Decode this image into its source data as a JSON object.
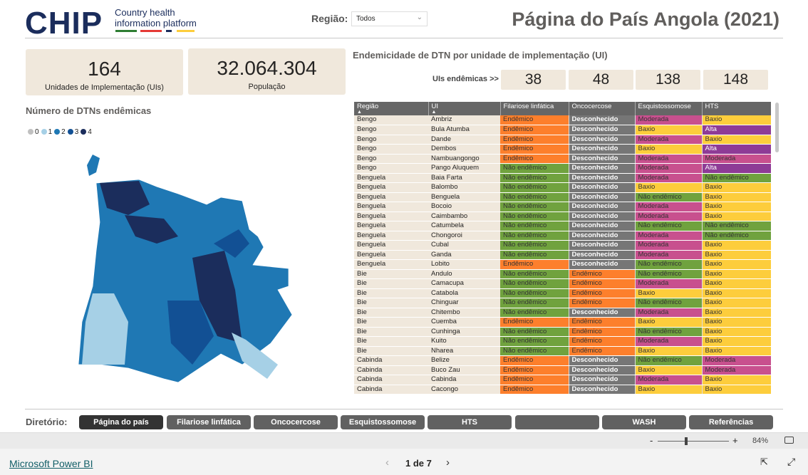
{
  "header": {
    "logo": "CHIP",
    "subtitle1": "Country health",
    "subtitle2": "information platform",
    "region_label": "Região:",
    "region_value": "Todos",
    "title": "Página do País Angola (2021)"
  },
  "cards": [
    {
      "value": "164",
      "label": "Unidades de Implementação (UIs)"
    },
    {
      "value": "32.064.304",
      "label": "População"
    }
  ],
  "map": {
    "title": "Número de DTNs endêmicas",
    "legend": [
      {
        "label": "0",
        "color": "#c0c0c0"
      },
      {
        "label": "1",
        "color": "#a6d0e6"
      },
      {
        "label": "2",
        "color": "#1f78b4"
      },
      {
        "label": "3",
        "color": "#125094"
      },
      {
        "label": "4",
        "color": "#1b2d5c"
      }
    ]
  },
  "endemic": {
    "title": "Endemicidade de DTN por unidade de implementação (UI)",
    "label": "UIs endêmicas >>",
    "counts": [
      "38",
      "48",
      "138",
      "148"
    ]
  },
  "table": {
    "headers": [
      "Região",
      "UI",
      "Filariose linfática",
      "Oncocercose",
      "Esquistossomose",
      "HTS"
    ],
    "colors": {
      "Endêmico": "#fd7f2c",
      "Desconhecido": "#767676",
      "Não endêmico": "#70a23e",
      "Moderada": "#c8508e",
      "Baxio": "#fdcd3c",
      "Alta": "#8e3b96"
    },
    "rows": [
      [
        "Bengo",
        "Ambriz",
        "Endêmico",
        "Desconhecido",
        "Moderada",
        "Baxio"
      ],
      [
        "Bengo",
        "Bula Atumba",
        "Endêmico",
        "Desconhecido",
        "Baxio",
        "Alta"
      ],
      [
        "Bengo",
        "Dande",
        "Endêmico",
        "Desconhecido",
        "Moderada",
        "Baxio"
      ],
      [
        "Bengo",
        "Dembos",
        "Endêmico",
        "Desconhecido",
        "Baxio",
        "Alta"
      ],
      [
        "Bengo",
        "Nambuangongo",
        "Endêmico",
        "Desconhecido",
        "Moderada",
        "Moderada"
      ],
      [
        "Bengo",
        "Pango Aluquem",
        "Não endêmico",
        "Desconhecido",
        "Moderada",
        "Alta"
      ],
      [
        "Benguela",
        "Baia Farta",
        "Não endêmico",
        "Desconhecido",
        "Moderada",
        "Não endêmico"
      ],
      [
        "Benguela",
        "Balombo",
        "Não endêmico",
        "Desconhecido",
        "Baxio",
        "Baxio"
      ],
      [
        "Benguela",
        "Benguela",
        "Não endêmico",
        "Desconhecido",
        "Não endêmico",
        "Baxio"
      ],
      [
        "Benguela",
        "Bocoio",
        "Não endêmico",
        "Desconhecido",
        "Moderada",
        "Baxio"
      ],
      [
        "Benguela",
        "Caimbambo",
        "Não endêmico",
        "Desconhecido",
        "Moderada",
        "Baxio"
      ],
      [
        "Benguela",
        "Catumbela",
        "Não endêmico",
        "Desconhecido",
        "Não endêmico",
        "Não endêmico"
      ],
      [
        "Benguela",
        "Chongoroi",
        "Não endêmico",
        "Desconhecido",
        "Moderada",
        "Não endêmico"
      ],
      [
        "Benguela",
        "Cubal",
        "Não endêmico",
        "Desconhecido",
        "Moderada",
        "Baxio"
      ],
      [
        "Benguela",
        "Ganda",
        "Não endêmico",
        "Desconhecido",
        "Moderada",
        "Baxio"
      ],
      [
        "Benguela",
        "Lobito",
        "Endêmico",
        "Desconhecido",
        "Não endêmico",
        "Baxio"
      ],
      [
        "Bie",
        "Andulo",
        "Não endêmico",
        "Endêmico",
        "Não endêmico",
        "Baxio"
      ],
      [
        "Bie",
        "Camacupa",
        "Não endêmico",
        "Endêmico",
        "Moderada",
        "Baxio"
      ],
      [
        "Bie",
        "Catabola",
        "Não endêmico",
        "Endêmico",
        "Baxio",
        "Baxio"
      ],
      [
        "Bie",
        "Chinguar",
        "Não endêmico",
        "Endêmico",
        "Não endêmico",
        "Baxio"
      ],
      [
        "Bie",
        "Chitembo",
        "Não endêmico",
        "Desconhecido",
        "Moderada",
        "Baxio"
      ],
      [
        "Bie",
        "Cuemba",
        "Endêmico",
        "Endêmico",
        "Baxio",
        "Baxio"
      ],
      [
        "Bie",
        "Cunhinga",
        "Não endêmico",
        "Endêmico",
        "Não endêmico",
        "Baxio"
      ],
      [
        "Bie",
        "Kuito",
        "Não endêmico",
        "Endêmico",
        "Moderada",
        "Baxio"
      ],
      [
        "Bie",
        "Nharea",
        "Não endêmico",
        "Endêmico",
        "Baxio",
        "Baxio"
      ],
      [
        "Cabinda",
        "Belize",
        "Endêmico",
        "Desconhecido",
        "Não endêmico",
        "Moderada"
      ],
      [
        "Cabinda",
        "Buco Zau",
        "Endêmico",
        "Desconhecido",
        "Baxio",
        "Moderada"
      ],
      [
        "Cabinda",
        "Cabinda",
        "Endêmico",
        "Desconhecido",
        "Moderada",
        "Baxio"
      ],
      [
        "Cabinda",
        "Cacongo",
        "Endêmico",
        "Desconhecido",
        "Baxio",
        "Baxio"
      ]
    ]
  },
  "nav": {
    "label": "Diretório:",
    "buttons": [
      "Página do país",
      "Filariose linfática",
      "Oncocercose",
      "Esquistossomose",
      "HTS",
      "",
      "WASH",
      "Referências"
    ]
  },
  "zoom": {
    "minus": "-",
    "plus": "+",
    "level": "84%",
    "value": 84
  },
  "footer": {
    "brand": "Microsoft Power BI",
    "page": "1 de 7"
  }
}
